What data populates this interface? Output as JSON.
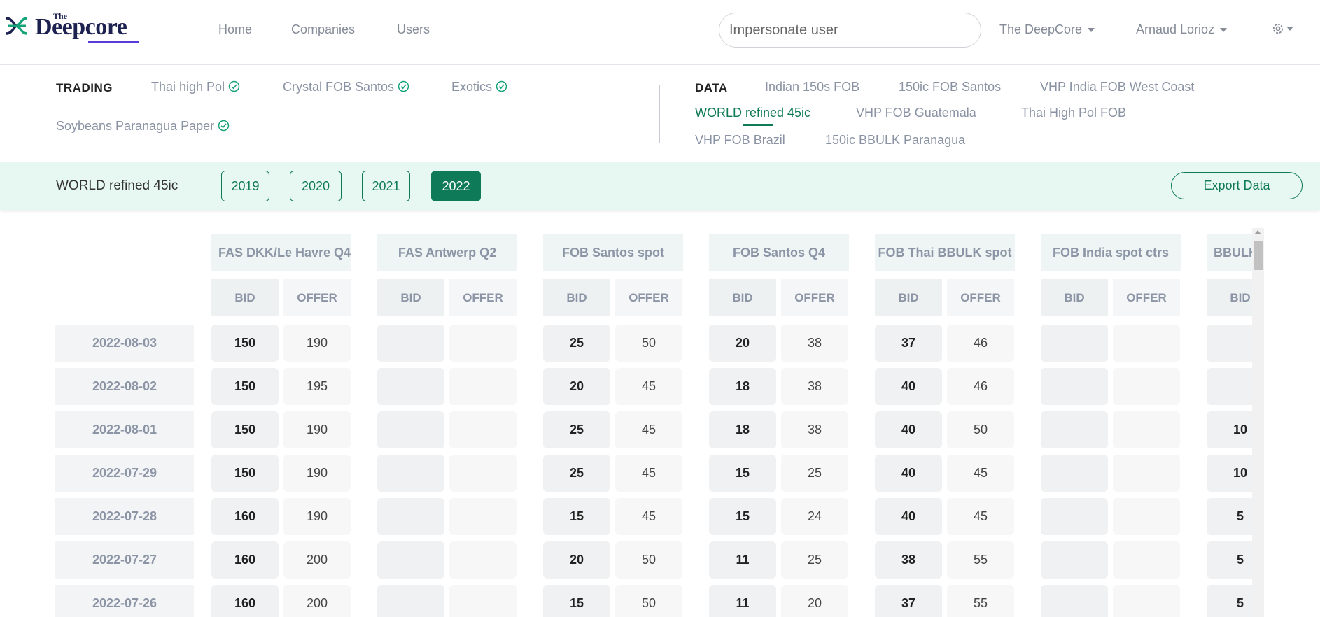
{
  "brand": {
    "the": "The",
    "name": "Deepcore"
  },
  "nav": {
    "links": [
      "Home",
      "Companies",
      "Users"
    ]
  },
  "header": {
    "search_placeholder": "Impersonate user",
    "org_dropdown": "The DeepCore",
    "user_dropdown": "Arnaud Lorioz",
    "settings_icon": "gear-icon"
  },
  "trading": {
    "title": "TRADING",
    "items": [
      "Thai high Pol",
      "Crystal FOB Santos",
      "Exotics",
      "Soybeans Paranagua Paper"
    ]
  },
  "data_section": {
    "title": "DATA",
    "items": [
      "Indian 150s FOB",
      "150ic FOB Santos",
      "VHP India FOB West Coast",
      "WORLD refined 45ic",
      "VHP FOB Guatemala",
      "Thai High Pol FOB",
      "VHP FOB Brazil",
      "150ic BBULK Paranagua"
    ],
    "active": "WORLD refined 45ic"
  },
  "toolbar": {
    "label": "WORLD refined 45ic",
    "years": [
      "2019",
      "2020",
      "2021",
      "2022"
    ],
    "selected_year": "2022",
    "export_label": "Export Data"
  },
  "table": {
    "columns": [
      "FAS DKK/Le Havre Q4",
      "FAS Antwerp Q2",
      "FOB Santos spot",
      "FOB Santos Q4",
      "FOB Thai BBULK spot",
      "FOB India spot ctrs",
      "BBULK"
    ],
    "bid_label": "BID",
    "offer_label": "OFFER",
    "dates": [
      "2022-08-03",
      "2022-08-02",
      "2022-08-01",
      "2022-07-29",
      "2022-07-28",
      "2022-07-27",
      "2022-07-26"
    ],
    "rows": [
      [
        [
          "150",
          "190"
        ],
        [
          "",
          ""
        ],
        [
          "25",
          "50"
        ],
        [
          "20",
          "38"
        ],
        [
          "37",
          "46"
        ],
        [
          "",
          ""
        ],
        [
          "",
          ""
        ]
      ],
      [
        [
          "150",
          "195"
        ],
        [
          "",
          ""
        ],
        [
          "20",
          "45"
        ],
        [
          "18",
          "38"
        ],
        [
          "40",
          "46"
        ],
        [
          "",
          ""
        ],
        [
          "",
          ""
        ]
      ],
      [
        [
          "150",
          "190"
        ],
        [
          "",
          ""
        ],
        [
          "25",
          "45"
        ],
        [
          "18",
          "38"
        ],
        [
          "40",
          "50"
        ],
        [
          "",
          ""
        ],
        [
          "10",
          ""
        ]
      ],
      [
        [
          "150",
          "190"
        ],
        [
          "",
          ""
        ],
        [
          "25",
          "45"
        ],
        [
          "15",
          "25"
        ],
        [
          "40",
          "45"
        ],
        [
          "",
          ""
        ],
        [
          "10",
          ""
        ]
      ],
      [
        [
          "160",
          "190"
        ],
        [
          "",
          ""
        ],
        [
          "15",
          "45"
        ],
        [
          "15",
          "24"
        ],
        [
          "40",
          "45"
        ],
        [
          "",
          ""
        ],
        [
          "5",
          ""
        ]
      ],
      [
        [
          "160",
          "200"
        ],
        [
          "",
          ""
        ],
        [
          "20",
          "50"
        ],
        [
          "11",
          "25"
        ],
        [
          "38",
          "55"
        ],
        [
          "",
          ""
        ],
        [
          "5",
          ""
        ]
      ],
      [
        [
          "160",
          "200"
        ],
        [
          "",
          ""
        ],
        [
          "15",
          "50"
        ],
        [
          "11",
          "20"
        ],
        [
          "37",
          "55"
        ],
        [
          "",
          ""
        ],
        [
          "5",
          ""
        ]
      ]
    ]
  },
  "colors": {
    "accent": "#0e7a57",
    "toolbar_bg": "#e7f7f1",
    "muted_text": "#8c95a6"
  }
}
